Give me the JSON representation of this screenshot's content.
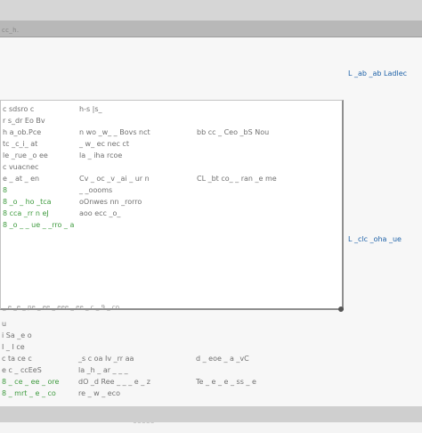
{
  "window": {
    "title": "cc_h."
  },
  "panel_rows": [
    {
      "c1": "c sdsro c",
      "c2": "",
      "c3": "h-s |s_",
      "c4": ""
    },
    {
      "c1": "r s_dr Eo Bv",
      "c2": "",
      "c3": "",
      "c4": ""
    },
    {
      "c1": "h a_ob.Pce",
      "c2": "",
      "c3": "n wo _w_ _ Bovs nct",
      "c4": "bb cc _ Ceo _bS Nou"
    },
    {
      "c1": "tc _c_i_ at",
      "c2": "",
      "c3": "_ w_ ec nec ct",
      "c4": ""
    },
    {
      "c1": "le _rue _o ee",
      "c2": "",
      "c3": "la _ iha rcoe",
      "c4": ""
    },
    {
      "c1": "c vuacnec",
      "c2": "",
      "c3": "",
      "c4": ""
    },
    {
      "c1": "e _ at _ en",
      "c2": "",
      "c3": "Cv _ oc _v _ai _ ur n",
      "c4": "CL _bt co_ _ ran _e me"
    },
    {
      "c1": "8",
      "c2": "",
      "c3": "_ _oooms",
      "c4": ""
    },
    {
      "c1": "8 _o _ ho _tca",
      "c2": "",
      "c3": "oOnwes nn _rorro",
      "c4": ""
    },
    {
      "c1": "8 cca _rr n eJ",
      "c2": "",
      "c3": "aoo ecc _o_",
      "c4": ""
    },
    {
      "c1": "8 _o _ _ ue _ _rro _ a",
      "c2": "",
      "c3": "",
      "c4": ""
    }
  ],
  "side_links": [
    "L _ab _ab Ladlec",
    "L _clc _oha _ue"
  ],
  "footnote": "_ e _e _ pe _ ee _ eee _ ee _ c _ 9 _ co",
  "lower_rows": [
    {
      "c1": "u",
      "c2": "",
      "c3": "",
      "c4": ""
    },
    {
      "c1": "i Sa _e o",
      "c2": "",
      "c3": "",
      "c4": ""
    },
    {
      "c1": "I _ I ce",
      "c2": "",
      "c3": "",
      "c4": ""
    },
    {
      "c1": "c ta ce c",
      "c2": "",
      "c3": "_s c oa Iv _rr aa",
      "c4": "d _ eoe _ a _vC"
    },
    {
      "c1": "e c _ ccEeS",
      "c2": "",
      "c3": "la _h _ ar _ _ _",
      "c4": ""
    },
    {
      "c1": "8 _ ce _ ee _ ore",
      "c2": "",
      "c3": "dO _d Ree _ _ _ e _ z",
      "c4": "Te _ e _ e _ ss _ e"
    },
    {
      "c1": "8 _ mrt _ e _ co",
      "c2": "",
      "c3": "re _ w _ eco",
      "c4": ""
    },
    {
      "c1": "",
      "c2": "",
      "c3": "",
      "c4": ""
    }
  ],
  "status_text": "_ _ _ _ _"
}
